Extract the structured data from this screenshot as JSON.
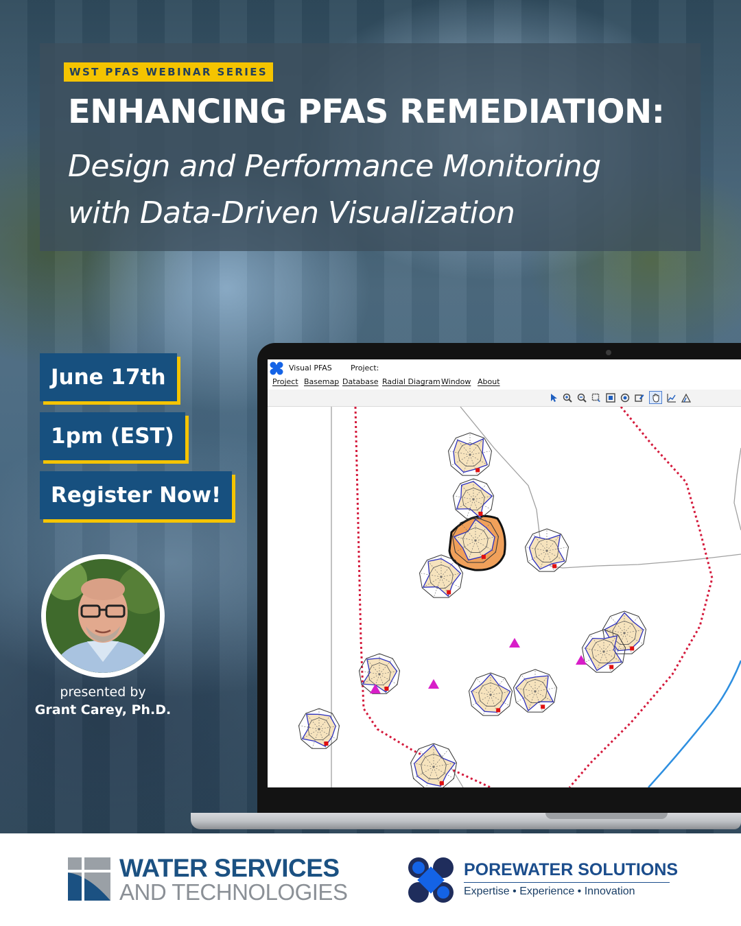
{
  "header": {
    "series_tag": "WST PFAS WEBINAR SERIES",
    "headline": "ENHANCING PFAS REMEDIATION:",
    "subhead_line1": "Design and Performance Monitoring",
    "subhead_line2": "with Data-Driven Visualization"
  },
  "event": {
    "date": "June 17th",
    "time": "1pm (EST)",
    "cta": "Register Now!"
  },
  "presenter": {
    "prefix": "presented by",
    "name": "Grant Carey, Ph.D."
  },
  "app": {
    "title": "Visual PFAS",
    "project_label": "Project:",
    "menu": [
      "Project",
      "Basemap",
      "Database",
      "Radial Diagram",
      "Window",
      "About"
    ],
    "tools": [
      "pointer-icon",
      "zoom-in-icon",
      "zoom-out-icon",
      "zoom-box-icon",
      "full-extent-icon",
      "zoom-layer-icon",
      "edit-icon",
      "pan-hand-icon",
      "chart-icon",
      "measure-icon"
    ]
  },
  "footer": {
    "wst_line1": "WATER SERVICES",
    "wst_line2": "AND TECHNOLOGIES",
    "porewater_name": "POREWATER SOLUTIONS",
    "porewater_tagline": "Expertise • Experience • Innovation"
  },
  "colors": {
    "navy": "#17507f",
    "accent_yellow": "#f5c400",
    "wst_blue": "#1b5182",
    "porewater_blue": "#1463e6",
    "boundary_red": "#d41a3c",
    "triangle_magenta": "#d81ec8",
    "highlight_orange": "#f0a05a",
    "radar_fill": "#f6e3bd"
  }
}
